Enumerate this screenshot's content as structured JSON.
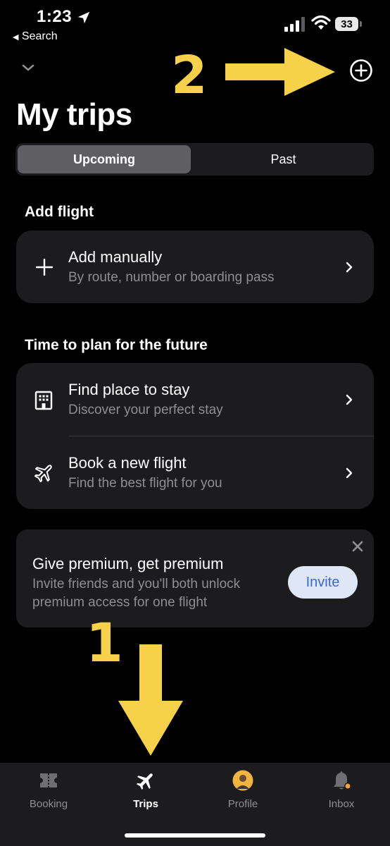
{
  "status_bar": {
    "time": "1:23",
    "back_label": "Search",
    "battery": "33"
  },
  "header": {
    "title": "My trips"
  },
  "segments": {
    "active": "Upcoming",
    "inactive": "Past"
  },
  "add_flight": {
    "heading": "Add flight",
    "item": {
      "title": "Add manually",
      "subtitle": "By route, number or boarding pass"
    }
  },
  "plan": {
    "heading": "Time to plan for the future",
    "items": [
      {
        "title": "Find place to stay",
        "subtitle": "Discover your perfect stay"
      },
      {
        "title": "Book a new flight",
        "subtitle": "Find the best flight for you"
      }
    ]
  },
  "promo": {
    "title": "Give premium, get premium",
    "line1": "Invite friends and you'll both unlock",
    "line2": "premium access for one flight",
    "button": "Invite"
  },
  "annotations": {
    "one": "1",
    "two": "2"
  },
  "tabbar": {
    "tabs": [
      {
        "label": "Booking",
        "icon": "ticket-icon"
      },
      {
        "label": "Trips",
        "icon": "airplane-icon",
        "active": true
      },
      {
        "label": "Profile",
        "icon": "avatar"
      },
      {
        "label": "Inbox",
        "icon": "bell-icon"
      }
    ]
  },
  "colors": {
    "annotation_yellow": "#f7d14a",
    "invite_text": "#3b6ad1",
    "badge_orange": "#f1a33a"
  }
}
